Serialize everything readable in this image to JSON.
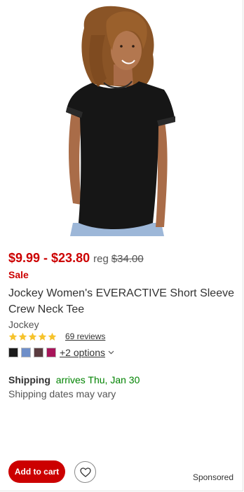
{
  "product": {
    "image_alt": "woman wearing black short sleeve crew neck tee",
    "price_range": "$9.99 - $23.80",
    "reg_label": "reg",
    "reg_price": "$34.00",
    "sale_label": "Sale",
    "title": "Jockey Women's EVERACTIVE Short Sleeve Crew Neck Tee",
    "brand": "Jockey",
    "rating": 5,
    "rating_max": 5,
    "reviews_label": "69 reviews",
    "swatches": [
      "#1b1b1b",
      "#6f8fc9",
      "#5a3b3f",
      "#a8155a"
    ],
    "more_options_label": "+2 options",
    "shipping_label": "Shipping",
    "shipping_arrives": "arrives Thu, Jan 30",
    "shipping_note": "Shipping dates may vary"
  },
  "actions": {
    "add_to_cart_label": "Add to cart",
    "favorite_icon": "heart-icon"
  },
  "sponsored_label": "Sponsored",
  "colors": {
    "accent_red": "#cc0000",
    "shipping_green": "#008300",
    "star_gold": "#f6c32c"
  }
}
